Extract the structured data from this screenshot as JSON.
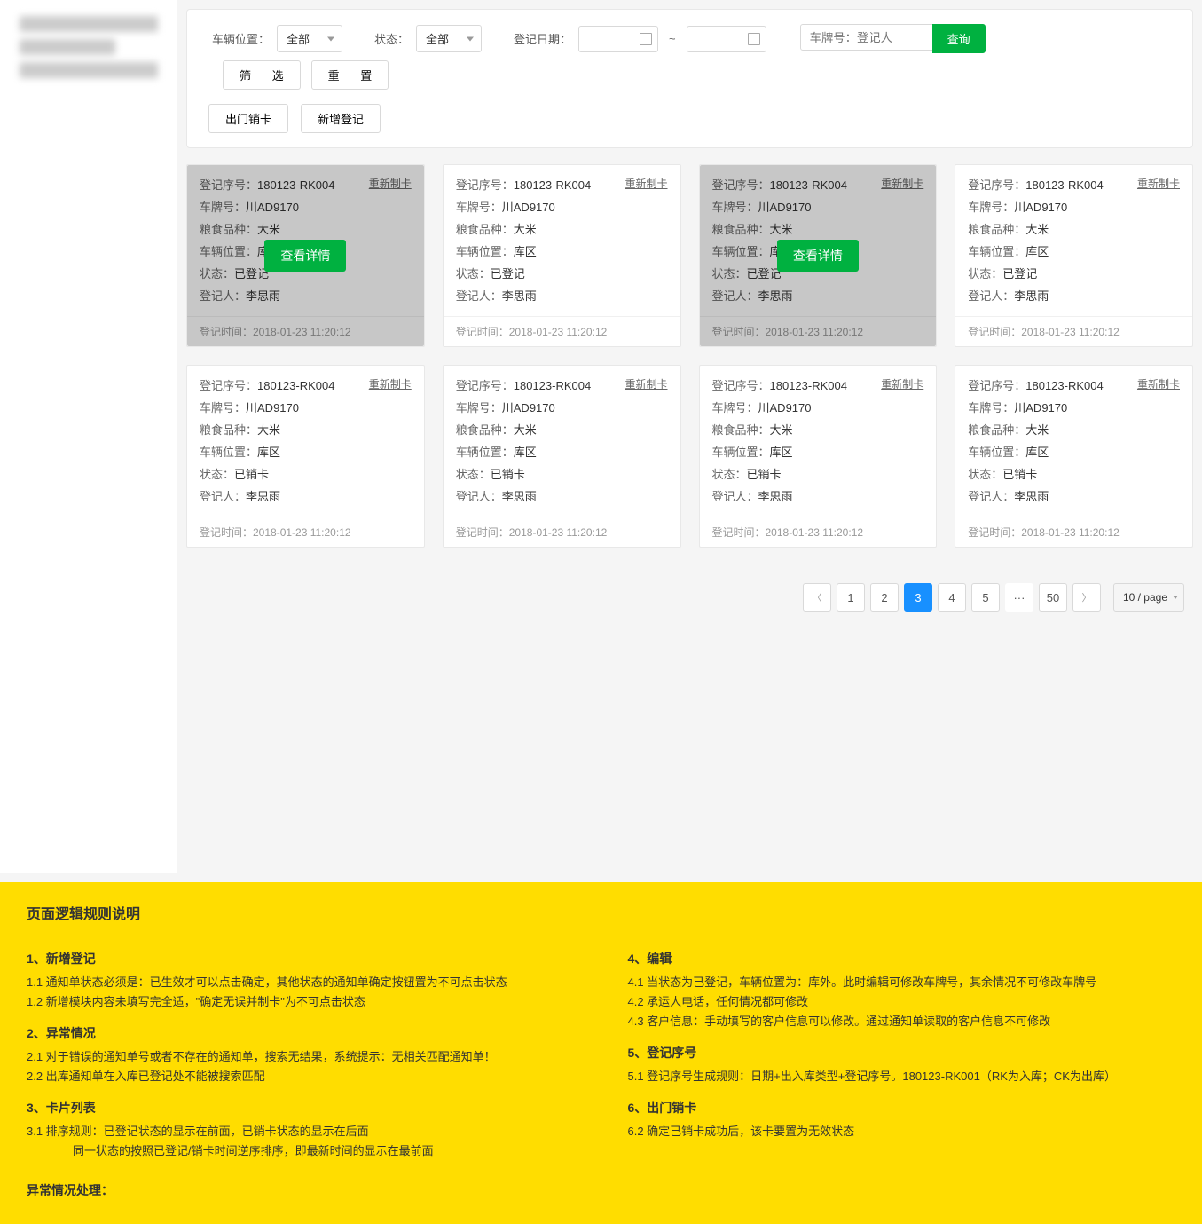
{
  "filters": {
    "veh_location_label": "车辆位置：",
    "veh_location_value": "全部",
    "status_label": "状态：",
    "status_value": "全部",
    "reg_date_label": "登记日期：",
    "tilde": "~",
    "search_placeholder": "车牌号：登记人",
    "query_btn": "查询",
    "filter_btn": "筛 选",
    "reset_btn": "重 置",
    "checkout_btn": "出门销卡",
    "register_btn": "新增登记"
  },
  "card_labels": {
    "reg_no": "登记序号：",
    "plate": "车牌号：",
    "grain": "粮食品种：",
    "location": "车辆位置：",
    "status": "状态：",
    "registrar": "登记人：",
    "reg_time": "登记时间：",
    "reprint": "重新制卡",
    "view": "查看详情"
  },
  "cards": [
    {
      "reg_no": "180123-RK004",
      "plate": "川AD9170",
      "grain": "大米",
      "location": "库区",
      "status": "已登记",
      "registrar": "李思雨",
      "reg_time": "2018-01-23   11:20:12",
      "overlay": true
    },
    {
      "reg_no": "180123-RK004",
      "plate": "川AD9170",
      "grain": "大米",
      "location": "库区",
      "status": "已登记",
      "registrar": "李思雨",
      "reg_time": "2018-01-23   11:20:12",
      "overlay": false
    },
    {
      "reg_no": "180123-RK004",
      "plate": "川AD9170",
      "grain": "大米",
      "location": "库区",
      "status": "已登记",
      "registrar": "李思雨",
      "reg_time": "2018-01-23   11:20:12",
      "overlay": true
    },
    {
      "reg_no": "180123-RK004",
      "plate": "川AD9170",
      "grain": "大米",
      "location": "库区",
      "status": "已登记",
      "registrar": "李思雨",
      "reg_time": "2018-01-23   11:20:12",
      "overlay": false
    },
    {
      "reg_no": "180123-RK004",
      "plate": "川AD9170",
      "grain": "大米",
      "location": "库区",
      "status": "已销卡",
      "registrar": "李思雨",
      "reg_time": "2018-01-23   11:20:12",
      "overlay": false
    },
    {
      "reg_no": "180123-RK004",
      "plate": "川AD9170",
      "grain": "大米",
      "location": "库区",
      "status": "已销卡",
      "registrar": "李思雨",
      "reg_time": "2018-01-23   11:20:12",
      "overlay": false
    },
    {
      "reg_no": "180123-RK004",
      "plate": "川AD9170",
      "grain": "大米",
      "location": "库区",
      "status": "已销卡",
      "registrar": "李思雨",
      "reg_time": "2018-01-23   11:20:12",
      "overlay": false
    },
    {
      "reg_no": "180123-RK004",
      "plate": "川AD9170",
      "grain": "大米",
      "location": "库区",
      "status": "已销卡",
      "registrar": "李思雨",
      "reg_time": "2018-01-23   11:20:12",
      "overlay": false
    }
  ],
  "pagination": {
    "pages": [
      "1",
      "2",
      "3",
      "4",
      "5"
    ],
    "active": "3",
    "ellipsis": "···",
    "last": "50",
    "size": "10 / page"
  },
  "rules": {
    "title": "页面逻辑规则说明",
    "left": {
      "s1_h": "1、新增登记",
      "s1_1": "1.1 通知单状态必须是：已生效才可以点击确定，其他状态的通知单确定按钮置为不可点击状态",
      "s1_2": "1.2 新增模块内容未填写完全适，\"确定无误并制卡\"为不可点击状态",
      "s2_h": "2、异常情况",
      "s2_1": "2.1 对于错误的通知单号或者不存在的通知单，搜索无结果，系统提示：无相关匹配通知单！",
      "s2_2": "2.2 出库通知单在入库已登记处不能被搜索匹配",
      "s3_h": "3、卡片列表",
      "s3_1": "3.1 排序规则：已登记状态的显示在前面，已销卡状态的显示在后面",
      "s3_1b": "同一状态的按照已登记/销卡时间逆序排序，即最新时间的显示在最前面",
      "ex_h": "异常情况处理："
    },
    "right": {
      "s4_h": "4、编辑",
      "s4_1": "4.1 当状态为已登记，车辆位置为：库外。此时编辑可修改车牌号，其余情况不可修改车牌号",
      "s4_2": "4.2 承运人电话，任何情况都可修改",
      "s4_3": "4.3 客户信息：手动填写的客户信息可以修改。通过通知单读取的客户信息不可修改",
      "s5_h": "5、登记序号",
      "s5_1": "5.1 登记序号生成规则：日期+出入库类型+登记序号。180123-RK001（RK为入库；CK为出库）",
      "s6_h": "6、出门销卡",
      "s6_2": "6.2 确定已销卡成功后，该卡要置为无效状态"
    }
  }
}
